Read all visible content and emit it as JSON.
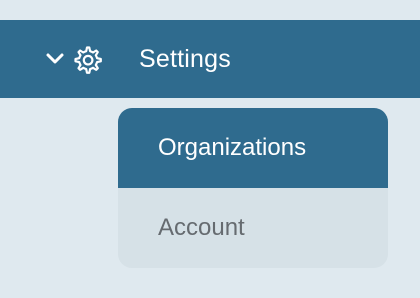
{
  "nav": {
    "settings": {
      "label": "Settings",
      "expanded": true,
      "icon": "gear-icon",
      "toggle_icon": "chevron-down-icon",
      "background_color": "#2f6b8e"
    },
    "submenu": {
      "items": [
        {
          "label": "Organizations",
          "active": true
        },
        {
          "label": "Account",
          "active": false
        }
      ],
      "active_color": "#2f6b8e",
      "inactive_color": "#d6e1e7"
    }
  },
  "page": {
    "background_color": "#dfe9ef"
  }
}
